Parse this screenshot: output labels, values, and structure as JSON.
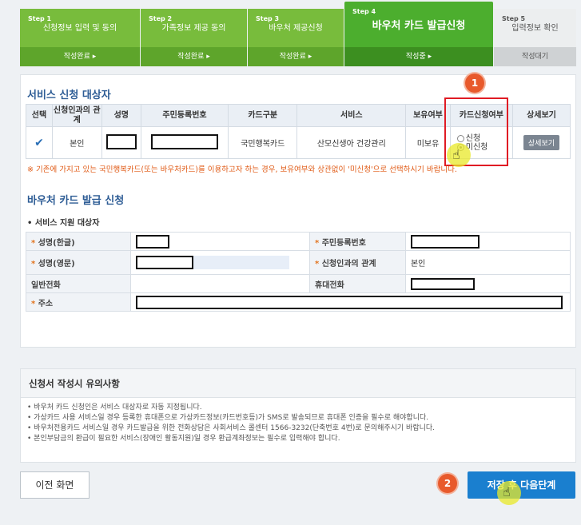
{
  "steps": [
    {
      "num": "Step 1",
      "title": "신청정보 입력 및 동의",
      "status": "작성완료 ▸"
    },
    {
      "num": "Step 2",
      "title": "가족정보 제공 동의",
      "status": "작성완료 ▸"
    },
    {
      "num": "Step 3",
      "title": "바우처 제공신청",
      "status": "작성완료 ▸"
    },
    {
      "num": "Step 4",
      "title": "바우처 카드 발급신청",
      "status": "작성중 ▸"
    },
    {
      "num": "Step 5",
      "title": "입력정보 확인",
      "status": "작성대기"
    }
  ],
  "section1": {
    "title": "서비스 신청 대상자",
    "headers": [
      "선택",
      "신청인과의 관계",
      "성명",
      "주민등록번호",
      "카드구분",
      "서비스",
      "보유여부",
      "카드신청여부",
      "상세보기"
    ],
    "row": {
      "relation": "본인",
      "card_type": "국민행복카드",
      "service": "산모신생아 건강관리",
      "holding": "미보유",
      "radio_apply": "신청",
      "radio_no": "미신청",
      "detail_button": "상세보기"
    },
    "notice": "※ 기존에 가지고 있는 국민행복카드(또는 바우처카드)를 이용하고자 하는 경우, 보유여부와 상관없이 '미신청'으로 선택하시기 바랍니다."
  },
  "section2": {
    "title": "바우처 카드 발급 신청",
    "subtitle": "• 서비스 지원 대상자",
    "labels": {
      "name_kr": "성명(한글)",
      "rrn": "주민등록번호",
      "name_en": "성명(영문)",
      "relation": "신청인과의 관계",
      "phone": "일반전화",
      "mobile": "휴대전화",
      "address": "주소"
    },
    "relation_value": "본인",
    "star": "*"
  },
  "notes": {
    "title": "신청서 작성시 유의사항",
    "items": [
      "• 바우처 카드 신청인은 서비스 대상자로 자동 지정됩니다.",
      "• 가상카드 사용 서비스일 경우 등록한 휴대폰으로 가상카드정보(카드번호등)가 SMS로 발송되므로 휴대폰 인증을 필수로 해야합니다.",
      "• 바우처전용카드 서비스일 경우 카드발급을 위한 전화상담은 사회서비스 콜센터 1566-3232(단축번호 4번)로 문의해주시기 바랍니다.",
      "• 본인부담금의 환급이 필요한 서비스(장애인 활동지원)일 경우 환급계좌정보는 필수로 입력해야 합니다."
    ]
  },
  "buttons": {
    "prev": "이전 화면",
    "next": "저장 후 다음단계"
  },
  "badges": {
    "one": "1",
    "two": "2"
  },
  "colors": {
    "accent": "#1a7fcf",
    "step_green": "#4cae2e",
    "title_blue": "#2d5c95",
    "notice_orange": "#e05a15",
    "highlight_red": "#e01b24"
  }
}
